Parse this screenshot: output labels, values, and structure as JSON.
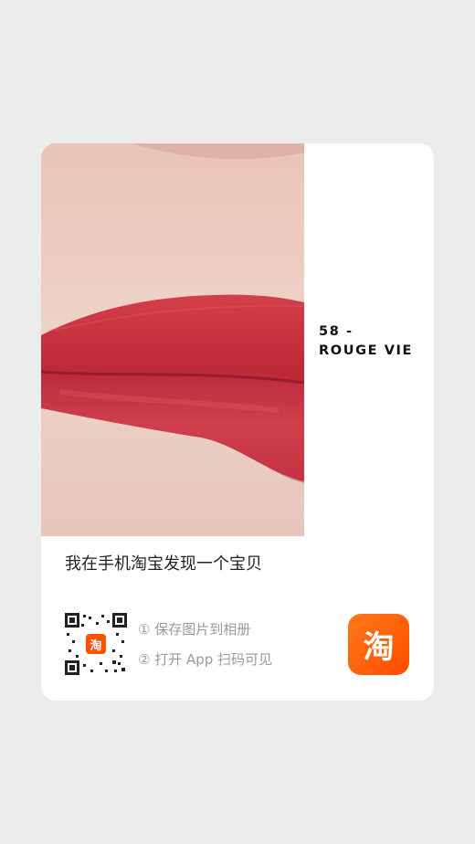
{
  "product_image": {
    "shade_number": "58 -",
    "shade_name": "ROUGE VIE",
    "lip_color": "#c8303c"
  },
  "share_card": {
    "headline": "我在手机淘宝发现一个宝贝",
    "steps": [
      "① 保存图片到相册",
      "② 打开 App 扫码可见"
    ],
    "qr_logo_text": "淘",
    "app_icon_text": "淘",
    "brand_color": "#ff5000"
  }
}
